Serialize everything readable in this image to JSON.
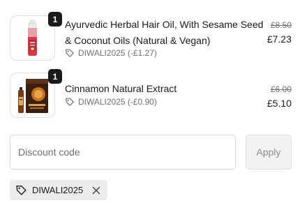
{
  "items": [
    {
      "quantity": "1",
      "title": "Ayurvedic Herbal Hair Oil, With Sesame Seed & Coconut Oils (Natural & Vegan)",
      "discount": "DIWALI2025 (-£1.27)",
      "original_price": "£8.50",
      "price": "£7.23",
      "image": "hair-oil-bottle-image"
    },
    {
      "quantity": "1",
      "title": "Cinnamon Natural Extract",
      "discount": "DIWALI2025 (-£0.90)",
      "original_price": "£6.00",
      "price": "£5.10",
      "image": "cinnamon-extract-box-image"
    }
  ],
  "discount_form": {
    "placeholder": "Discount code",
    "value": "",
    "apply_label": "Apply"
  },
  "applied_code": {
    "code": "DIWALI2025"
  },
  "icons": {
    "tag": "tag-icon",
    "remove": "close-icon"
  },
  "colors": {
    "badge": "#1a1a1a",
    "muted_text": "#707070",
    "chip_bg": "#ececec",
    "apply_bg": "#f2f2f2"
  }
}
